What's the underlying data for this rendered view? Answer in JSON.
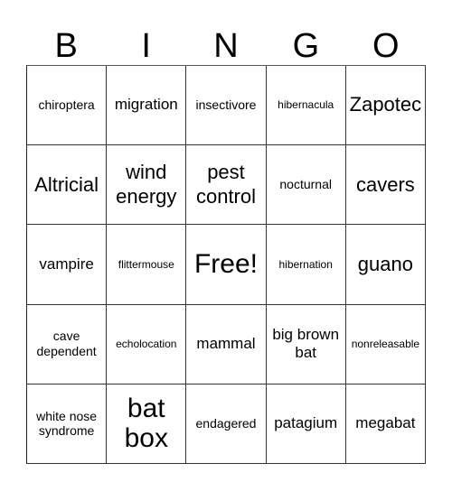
{
  "header": [
    "B",
    "I",
    "N",
    "G",
    "O"
  ],
  "cells": [
    {
      "text": "chiroptera",
      "size": "fs-sm"
    },
    {
      "text": "migration",
      "size": "fs-md"
    },
    {
      "text": "insectivore",
      "size": "fs-sm"
    },
    {
      "text": "hibernacula",
      "size": "fs-xs"
    },
    {
      "text": "Zapotec",
      "size": "fs-lg"
    },
    {
      "text": "Altricial",
      "size": "fs-lg"
    },
    {
      "text": "wind energy",
      "size": "fs-lg"
    },
    {
      "text": "pest control",
      "size": "fs-lg"
    },
    {
      "text": "nocturnal",
      "size": "fs-sm"
    },
    {
      "text": "cavers",
      "size": "fs-lg"
    },
    {
      "text": "vampire",
      "size": "fs-md"
    },
    {
      "text": "flittermouse",
      "size": "fs-xs"
    },
    {
      "text": "Free!",
      "size": "fs-xl"
    },
    {
      "text": "hibernation",
      "size": "fs-xs"
    },
    {
      "text": "guano",
      "size": "fs-lg"
    },
    {
      "text": "cave dependent",
      "size": "fs-sm"
    },
    {
      "text": "echolocation",
      "size": "fs-xs"
    },
    {
      "text": "mammal",
      "size": "fs-md"
    },
    {
      "text": "big brown bat",
      "size": "fs-md"
    },
    {
      "text": "nonreleasable",
      "size": "fs-xs"
    },
    {
      "text": "white nose syndrome",
      "size": "fs-sm"
    },
    {
      "text": "bat box",
      "size": "fs-xl"
    },
    {
      "text": "endagered",
      "size": "fs-sm"
    },
    {
      "text": "patagium",
      "size": "fs-md"
    },
    {
      "text": "megabat",
      "size": "fs-md"
    }
  ]
}
